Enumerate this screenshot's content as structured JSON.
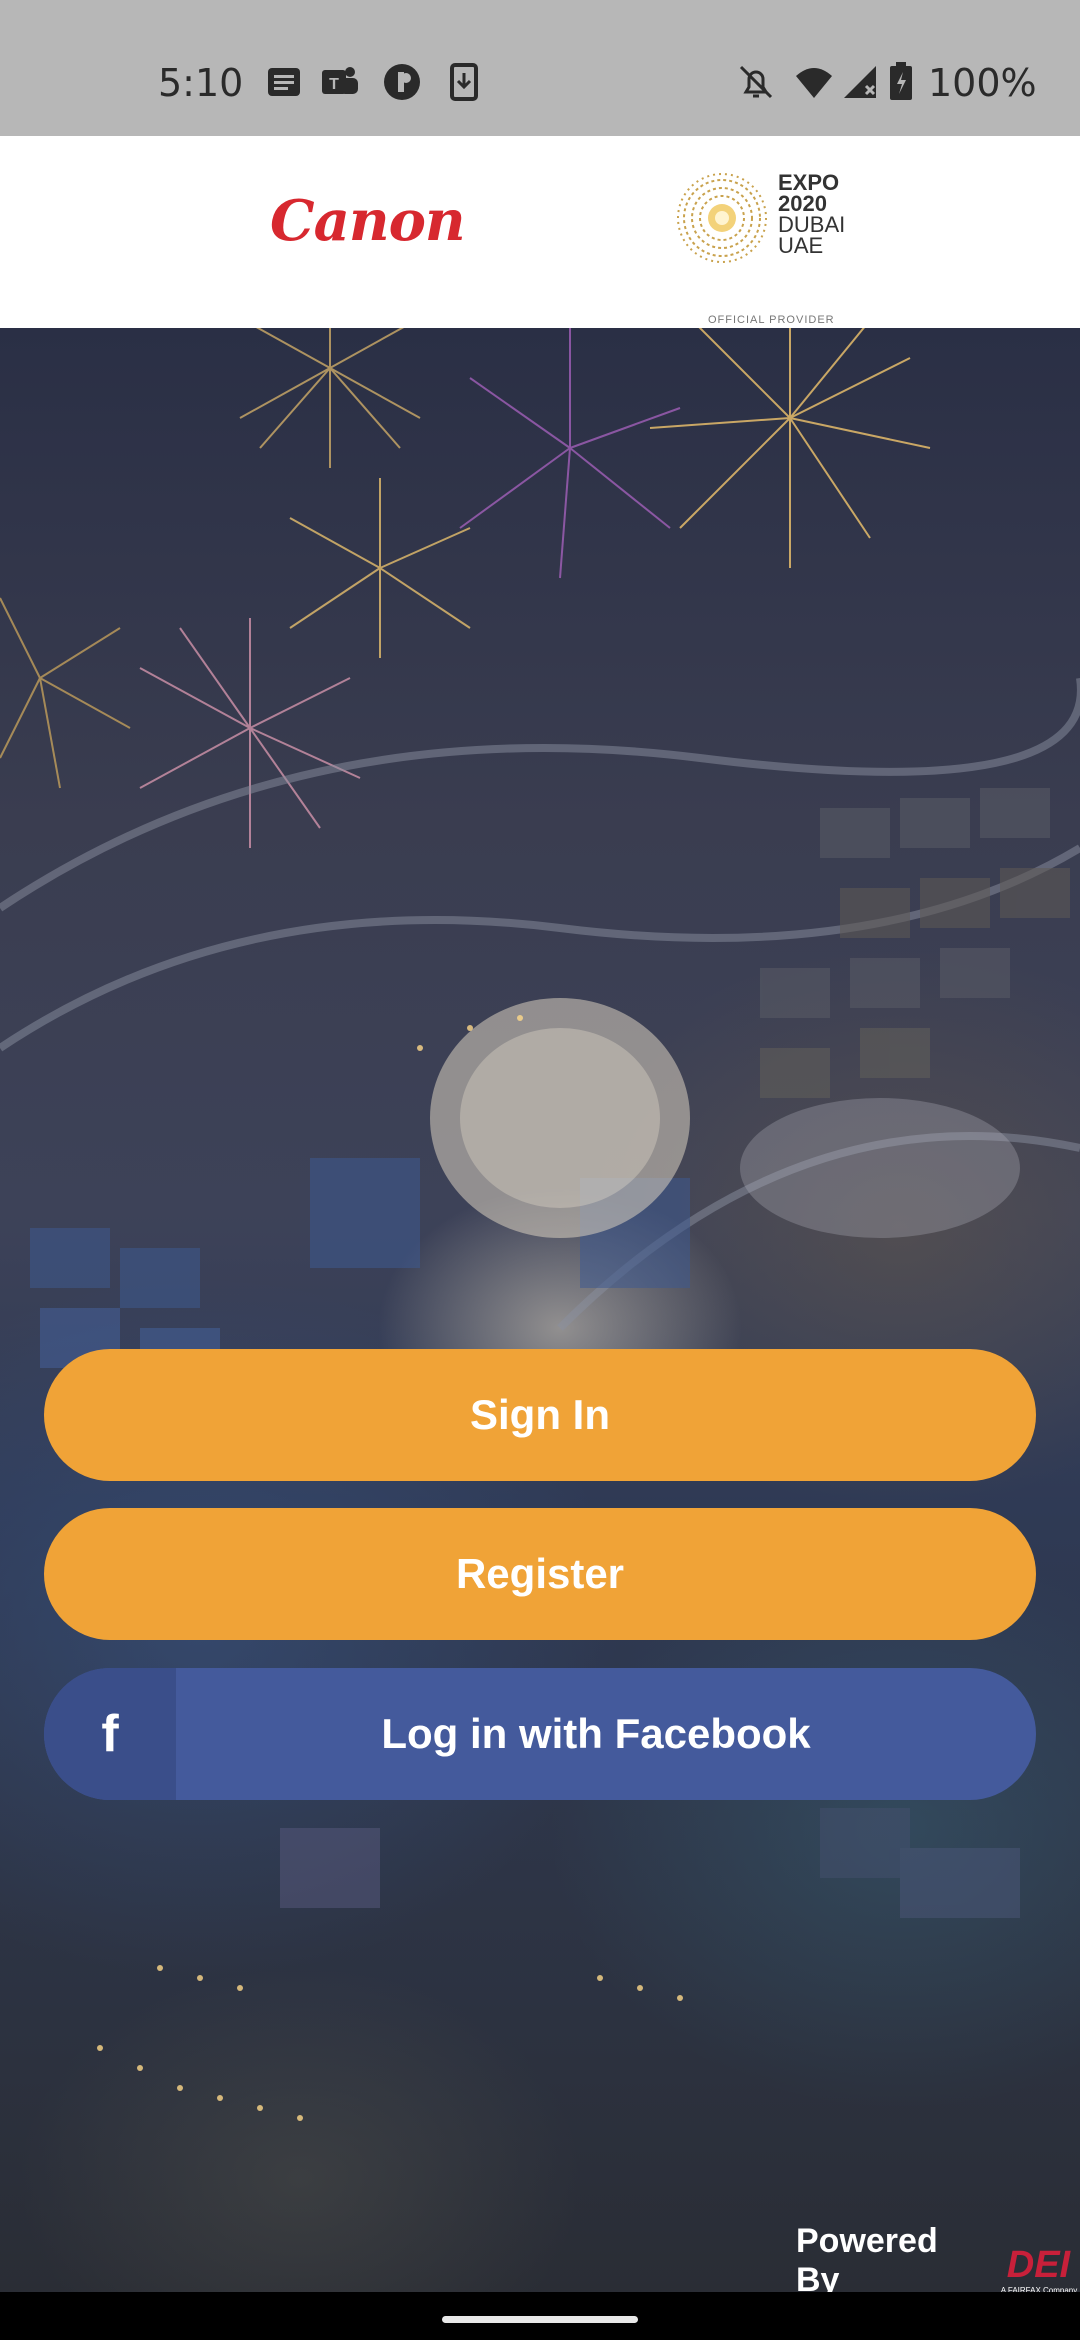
{
  "status_bar": {
    "time": "5:10",
    "battery": "100%",
    "left_icons": [
      "message-icon",
      "teams-icon",
      "app-circle-icon",
      "download-icon"
    ],
    "right_icons": [
      "bell-off-icon",
      "wifi-icon",
      "signal-icon",
      "battery-icon"
    ]
  },
  "header": {
    "brand_logo": "Canon",
    "partner_logo": {
      "line1": "EXPO",
      "line2": "2020",
      "line3": "DUBAI",
      "line4": "UAE",
      "subtitle": "OFFICIAL PROVIDER"
    }
  },
  "actions": {
    "sign_in": "Sign In",
    "register": "Register",
    "facebook": "Log in with Facebook",
    "facebook_icon": "f"
  },
  "footer": {
    "powered_by": "Powered By",
    "dei_logo": "DEI",
    "dei_tagline": "A FAIRFAX Company"
  },
  "colors": {
    "primary_button": "#f0a337",
    "facebook": "#445a9c",
    "brand_red": "#d7282f"
  }
}
